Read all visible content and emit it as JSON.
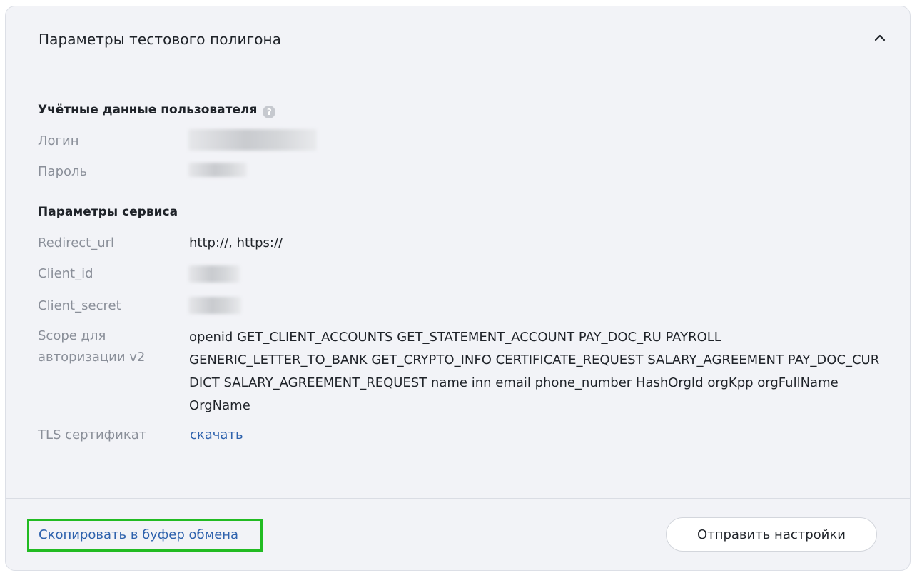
{
  "panel": {
    "title": "Параметры тестового полигона",
    "collapse_icon": "chevron-up-icon"
  },
  "credentials": {
    "title": "Учётные данные пользователя",
    "help_icon": "question-circle-icon",
    "help_glyph": "?",
    "login_label": "Логин",
    "password_label": "Пароль"
  },
  "service": {
    "title": "Параметры сервиса",
    "redirect_label": "Redirect_url",
    "redirect_value": "http://, https://",
    "client_id_label": "Client_id",
    "client_secret_label": "Client_secret",
    "scope_label": "Scope для авторизации v2",
    "scope_value": "openid GET_CLIENT_ACCOUNTS GET_STATEMENT_ACCOUNT PAY_DOC_RU PAYROLL GENERIC_LETTER_TO_BANK GET_CRYPTO_INFO CERTIFICATE_REQUEST SALARY_AGREEMENT PAY_DOC_CUR DICT SALARY_AGREEMENT_REQUEST name inn email phone_number HashOrgId orgKpp orgFullName OrgName",
    "tls_label": "TLS сертификат",
    "tls_link": "скачать"
  },
  "footer": {
    "copy_label": "Скопировать в буфер обмена",
    "send_label": "Отправить настройки"
  },
  "colors": {
    "panel_bg": "#f2f3f7",
    "link": "#2e62ad",
    "highlight": "#22bb22",
    "label_gray": "#8a8f99"
  }
}
